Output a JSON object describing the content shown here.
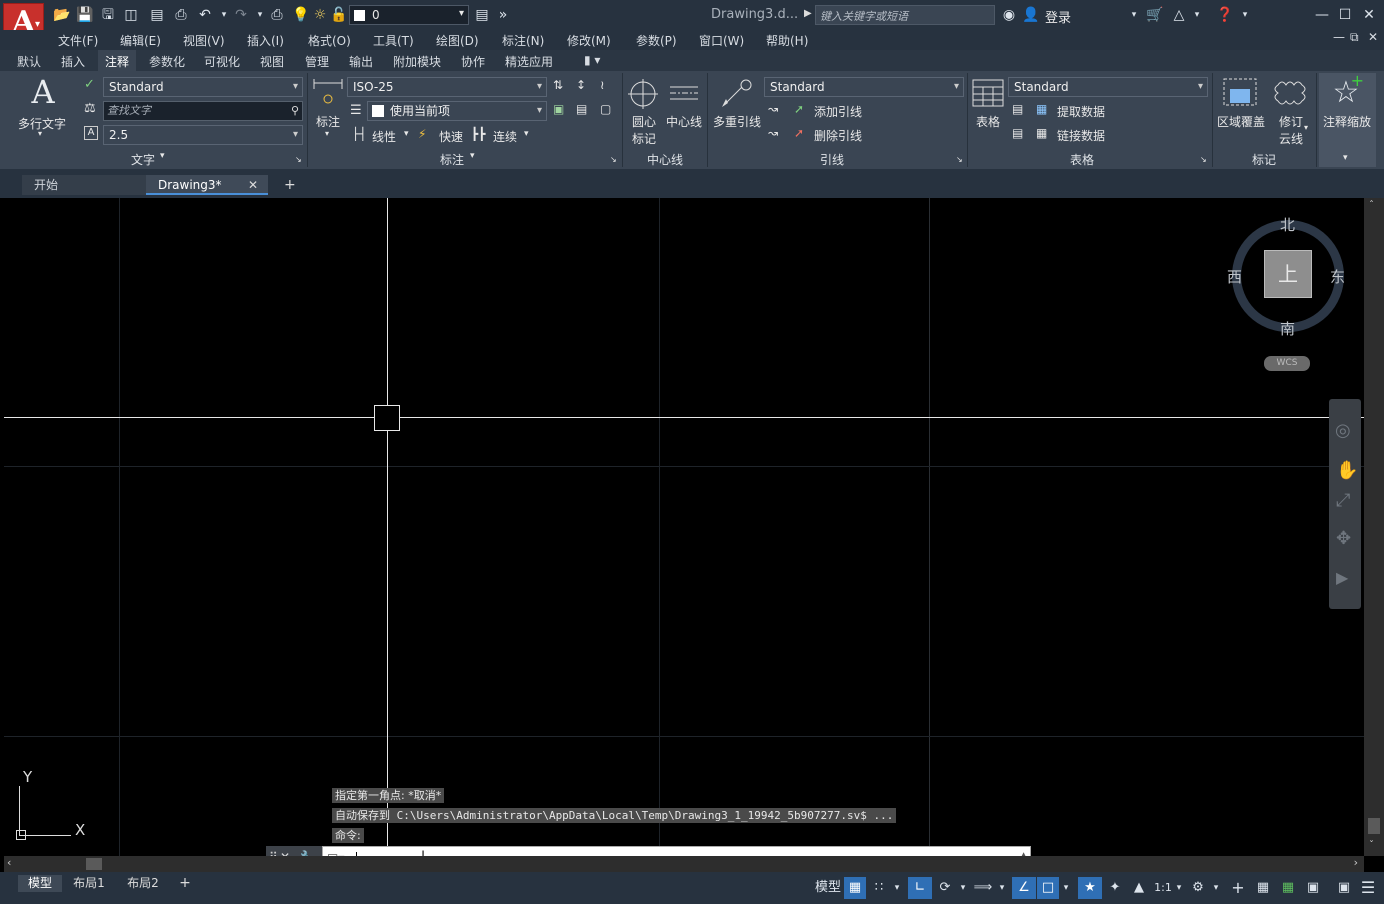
{
  "app": {
    "logo_letter": "A",
    "logo_sub": "▾",
    "doc_title": "Drawing3.d...",
    "search_placeholder": "键入关键字或短语",
    "login": "登录",
    "layer_value": "0"
  },
  "icons": {
    "quick_access": [
      "open-icon",
      "save-icon",
      "save-as-icon",
      "plot-icon",
      "publish-icon",
      "print-icon",
      "undo-icon",
      "redo-icon"
    ],
    "help": "help-icon"
  },
  "menu": [
    "文件(F)",
    "编辑(E)",
    "视图(V)",
    "插入(I)",
    "格式(O)",
    "工具(T)",
    "绘图(D)",
    "标注(N)",
    "修改(M)",
    "参数(P)",
    "窗口(W)",
    "帮助(H)"
  ],
  "ribbon_tabs": [
    "默认",
    "插入",
    "注释",
    "参数化",
    "可视化",
    "视图",
    "管理",
    "输出",
    "附加模块",
    "协作",
    "精选应用"
  ],
  "active_ribbon_tab": "注释",
  "text_panel": {
    "big_label": "多行文字",
    "style": "Standard",
    "find_placeholder": "查找文字",
    "height": "2.5",
    "title": "文字"
  },
  "dim_panel": {
    "big_label": "标注",
    "style": "ISO-25",
    "layer": "使用当前项",
    "linear": "线性",
    "quick": "快速",
    "continue": "连续",
    "title": "标注"
  },
  "center_panel": {
    "center_mark": "圆心",
    "center_mark2": "标记",
    "centerline": "中心线",
    "title": "中心线"
  },
  "leader_panel": {
    "big_label": "多重引线",
    "style": "Standard",
    "add": "添加引线",
    "remove": "删除引线",
    "title": "引线"
  },
  "table_panel": {
    "big_label": "表格",
    "style": "Standard",
    "extract": "提取数据",
    "link": "链接数据",
    "title": "表格"
  },
  "markup_panel": {
    "wipeout": "区域覆盖",
    "revcloud": "修订",
    "revcloud2": "云线",
    "title": "标记"
  },
  "annoscale": {
    "label": "注释缩放"
  },
  "doc_tabs": [
    {
      "label": "开始"
    },
    {
      "label": "Drawing3*"
    }
  ],
  "viewcube": {
    "north": "北",
    "south": "南",
    "east": "东",
    "west": "西",
    "top": "上",
    "wcs": "WCS"
  },
  "ucs": {
    "x": "X",
    "y": "Y"
  },
  "command_history": [
    "指定第一角点: *取消*",
    "自动保存到 C:\\Users\\Administrator\\AppData\\Local\\Temp\\Drawing3_1_19942_5b907277.sv$ ...",
    "命令:"
  ],
  "command_input": "",
  "layout_tabs": [
    "模型",
    "布局1",
    "布局2"
  ],
  "status": {
    "model": "模型",
    "scale": "1:1"
  }
}
